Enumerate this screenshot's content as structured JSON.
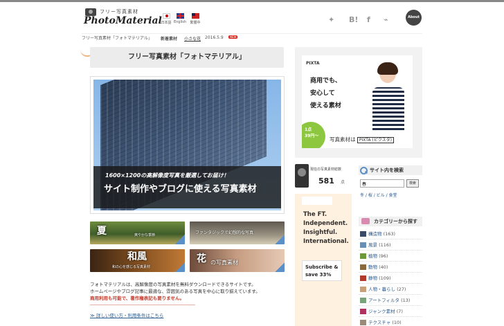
{
  "logo": {
    "tagline": "フリー写真素材",
    "name": "PhotoMaterial"
  },
  "languages": [
    {
      "label": "日本語"
    },
    {
      "label": "English"
    },
    {
      "label": "繁體中"
    }
  ],
  "about_label": "About",
  "breadcrumb": {
    "trail": "フリー写真素材「フォトマテリアル」",
    "new_label": "新着素材",
    "new_link": "小さな花",
    "new_date": "2016.5.9",
    "badge": "NEW"
  },
  "main": {
    "title": "フリー写真素材「フォトマテリアル」",
    "hero_sub": "1600×1200の高解像度写真を厳選してお届け！",
    "hero_main": "サイト制作やブログに使える写真素材",
    "thumbs": [
      {
        "title": "夏",
        "sub": "爽やかな季節"
      },
      {
        "title": "",
        "sub": "ファンタジックで幻想的な写真"
      },
      {
        "title": "和風",
        "sub": "和の心を感じる写真素材"
      },
      {
        "title": "花",
        "sub": "の写真素材"
      }
    ],
    "intro_1": "フォトマテリアルは、高解像度の写真素材を無料ダウンロードできるサイトです。",
    "intro_2": "ホームページやブログ記事に最適な、雰囲気のある写真を中心に取り揃えています。",
    "intro_red": "商用利用も可能で、著作権表記も要りません。",
    "more_link": "詳しい使い方・利用条件はこちら"
  },
  "ad_pixta": {
    "logo": "PIXTA",
    "line1": "商用でも、",
    "line2": "安心して",
    "line3": "使える素材",
    "price_1": "1点",
    "price_2": "39円〜",
    "bottom": "写真素材は",
    "bottom_box": "PIXTA (ピクスタ)"
  },
  "count": {
    "label": "現在の写真素材総数",
    "value": "581",
    "unit": "点"
  },
  "search": {
    "heading": "サイト内を検索",
    "value": "春",
    "button": "検索",
    "tags": "冬 / 桜 / ビル / 食堂"
  },
  "ad_ft": {
    "line1": "The FT.",
    "line2": "Independent.",
    "line3": "Insightful.",
    "line4": "International.",
    "btn1": "Subscribe &",
    "btn2": "save 33%"
  },
  "categories": {
    "heading": "カテゴリーから探す",
    "items": [
      {
        "label": "構造物",
        "count": "(163)",
        "color": "#3a4a66"
      },
      {
        "label": "風景",
        "count": "(116)",
        "color": "#6a8fb5"
      },
      {
        "label": "植物",
        "count": "(96)",
        "color": "#6a9a3c"
      },
      {
        "label": "動物",
        "count": "(40)",
        "color": "#8a6a3c"
      },
      {
        "label": "静物",
        "count": "(109)",
        "color": "#b23a2c"
      },
      {
        "label": "人物・暮らし",
        "count": "(27)",
        "color": "#c9a07a"
      },
      {
        "label": "アートフィルタ",
        "count": "(13)",
        "color": "#7aa37a"
      },
      {
        "label": "ジャンク素材",
        "count": "(7)",
        "color": "#b03060"
      },
      {
        "label": "テクスチャ",
        "count": "(10)",
        "color": "#9a8a7a"
      }
    ]
  }
}
